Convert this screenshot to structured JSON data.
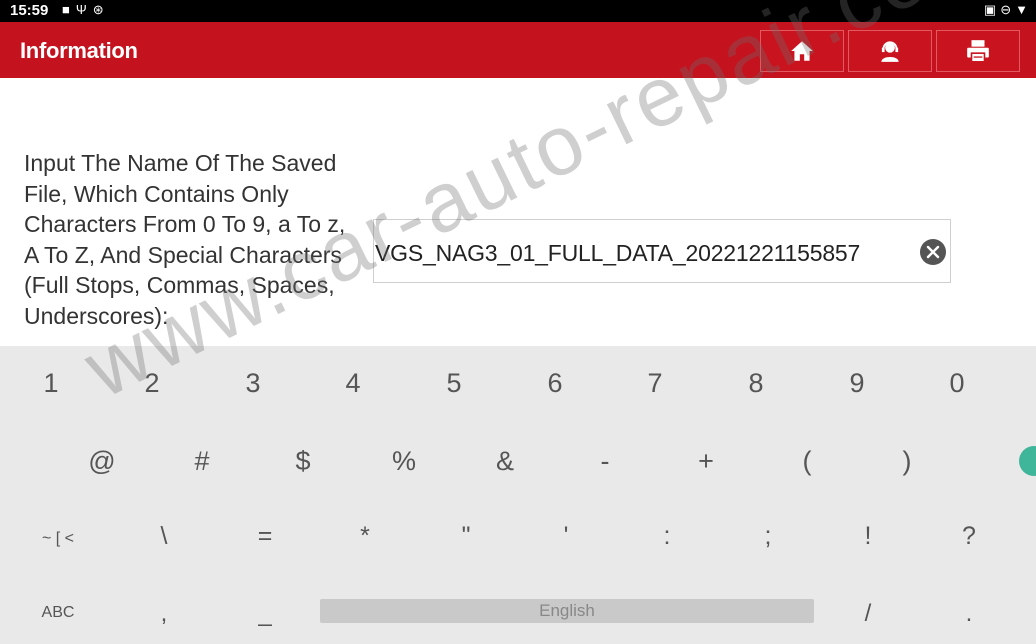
{
  "status_bar": {
    "time": "15:59",
    "left_icons": [
      "video-icon",
      "usb-icon",
      "sync-icon"
    ],
    "right_icons": [
      "cast-icon",
      "dnd-icon",
      "wifi-icon"
    ]
  },
  "header": {
    "title": "Information",
    "buttons": [
      "home-icon",
      "support-agent-icon",
      "printer-icon"
    ],
    "bg_color": "#c4121f"
  },
  "form": {
    "prompt": "Input The Name Of The Saved File, Which Contains Only Characters From 0 To 9, a To z, A To Z, And Special Characters (Full Stops, Commas, Spaces, Underscores):",
    "filename_value": "VGS_NAG3_01_FULL_DATA_20221221155857"
  },
  "keyboard": {
    "row1": [
      "1",
      "2",
      "3",
      "4",
      "5",
      "6",
      "7",
      "8",
      "9",
      "0"
    ],
    "row2": [
      "@",
      "#",
      "$",
      "%",
      "&",
      "-",
      "+",
      "(",
      ")"
    ],
    "row3": [
      "~ [ <",
      "\\",
      "=",
      "*",
      "\"",
      "'",
      ":",
      ";",
      "!",
      "?"
    ],
    "row4": {
      "abc": "ABC",
      "comma": ",",
      "underscore": "_",
      "space": "English",
      "slash": "/",
      "period": "."
    }
  },
  "watermark": "www.car-auto-repair.com"
}
